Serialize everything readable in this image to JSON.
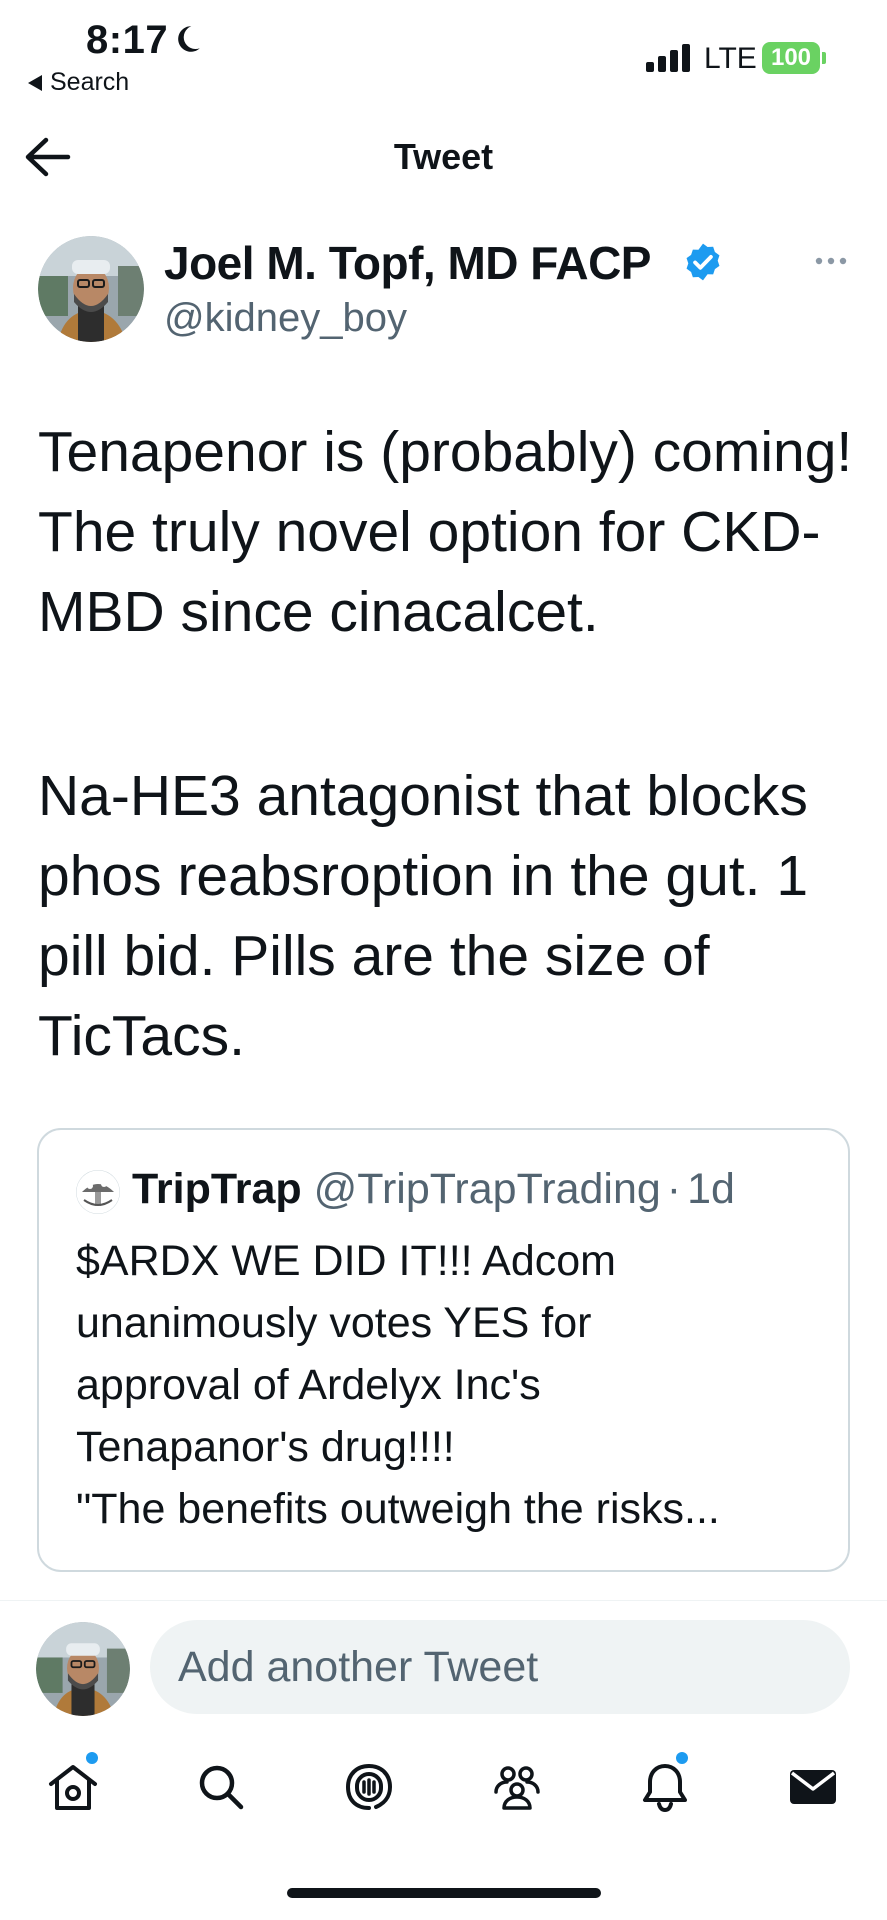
{
  "status_bar": {
    "time": "8:17",
    "back_app": "Search",
    "network": "LTE",
    "battery": "100"
  },
  "header": {
    "title": "Tweet"
  },
  "tweet": {
    "author_name": "Joel M. Topf, MD FACP",
    "author_handle": "@kidney_boy",
    "paragraphs": [
      "Tenapenor is (probably) coming! The truly novel option for CKD-MBD since cinacalcet.",
      "Na-HE3 antagonist that blocks phos reabsroption in the gut. 1 pill bid. Pills are the size of TicTacs."
    ]
  },
  "quote": {
    "name": "TripTrap",
    "handle": "@TripTrapTrading",
    "separator": "·",
    "time": "1d",
    "text": "$ARDX WE DID IT!!! Adcom\nunanimously votes YES for\napproval of Ardelyx Inc's\nTenapanor's drug!!!!\n\"The benefits outweigh the risks..."
  },
  "reply": {
    "placeholder": "Add another Tweet"
  },
  "bottom_nav": {
    "items": [
      "home-icon",
      "search-icon",
      "spaces-icon",
      "communities-icon",
      "notifications-icon",
      "messages-icon"
    ]
  },
  "colors": {
    "accent": "#1d9bf0",
    "text": "#0f1419",
    "secondary": "#536471",
    "battery": "#6ad262",
    "border": "#cfd9de"
  }
}
